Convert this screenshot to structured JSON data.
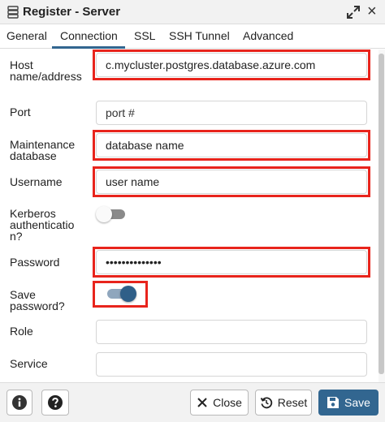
{
  "window": {
    "title": "Register - Server"
  },
  "tabs": [
    {
      "label": "General"
    },
    {
      "label": "Connection"
    },
    {
      "label": "SSL"
    },
    {
      "label": "SSH Tunnel"
    },
    {
      "label": "Advanced"
    }
  ],
  "active_tab": "Connection",
  "form": {
    "host": {
      "label": "Host\nname/address",
      "value": "c.mycluster.postgres.database.azure.com"
    },
    "port": {
      "label": "Port",
      "placeholder": "port #",
      "value": ""
    },
    "maintenance_db": {
      "label": "Maintenance\ndatabase",
      "value": "database name"
    },
    "username": {
      "label": "Username",
      "value": "user name"
    },
    "kerberos": {
      "label": "Kerberos\nauthenticatio\nn?",
      "enabled": false
    },
    "password": {
      "label": "Password",
      "value": "••••••••••••••"
    },
    "save_password": {
      "label": "Save\npassword?",
      "enabled": true
    },
    "role": {
      "label": "Role",
      "value": ""
    },
    "service": {
      "label": "Service",
      "value": ""
    }
  },
  "footer": {
    "close_label": "Close",
    "reset_label": "Reset",
    "save_label": "Save"
  },
  "colors": {
    "accent": "#326690",
    "highlight": "#e8241c"
  },
  "icons": {
    "title": "server-stack-icon",
    "expand": "expand-icon",
    "close": "close-icon",
    "info": "info-icon",
    "help": "help-icon",
    "close_button": "x-icon",
    "reset_button": "reset-icon",
    "save_button": "floppy-disk-icon"
  }
}
